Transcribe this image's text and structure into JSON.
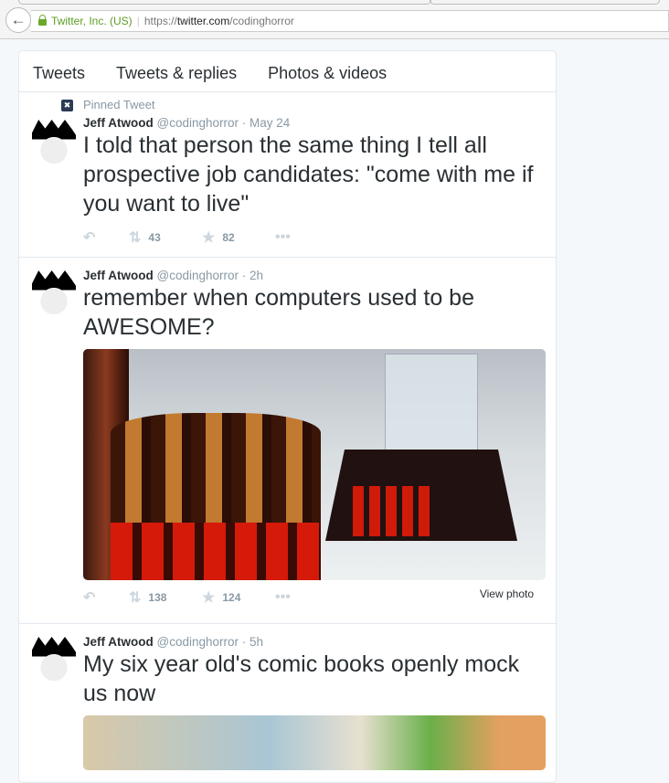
{
  "browser": {
    "identity": "Twitter, Inc. (US)",
    "url_proto": "https://",
    "url_host": "twitter.com",
    "url_path": "/codinghorror"
  },
  "tabs": [
    "Tweets",
    "Tweets & replies",
    "Photos & videos"
  ],
  "tweets": [
    {
      "pinned": "Pinned Tweet",
      "name": "Jeff Atwood",
      "handle": "@codinghorror",
      "time": "· May 24",
      "text": "I told that person the same thing I tell all prospective job candidates: \"come with me if you want to live\"",
      "retweets": "43",
      "favorites": "82"
    },
    {
      "name": "Jeff Atwood",
      "handle": "@codinghorror",
      "time": "· 2h",
      "text": "remember when computers used to be AWESOME?",
      "retweets": "138",
      "favorites": "124",
      "view_photo": "View photo"
    },
    {
      "name": "Jeff Atwood",
      "handle": "@codinghorror",
      "time": "· 5h",
      "text": "My six year old's comic books openly mock us now"
    }
  ]
}
